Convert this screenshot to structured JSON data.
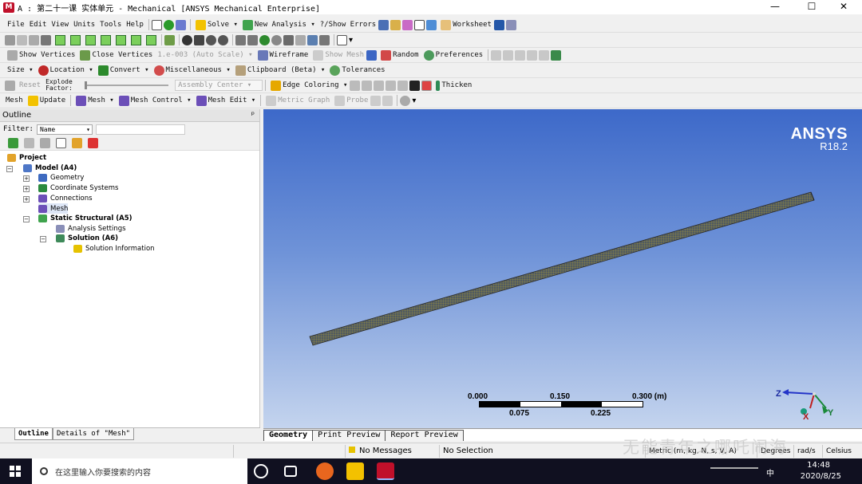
{
  "window": {
    "title": "A : 第二十一课 实体单元 - Mechanical [ANSYS Mechanical Enterprise]",
    "app_letter": "M"
  },
  "menu": [
    "File",
    "Edit",
    "View",
    "Units",
    "Tools",
    "Help"
  ],
  "toolbar1": {
    "solve": "Solve",
    "new_analysis": "New Analysis",
    "show_errors": "?/Show Errors",
    "worksheet": "Worksheet"
  },
  "toolbar2": {
    "show_vertices": "Show Vertices",
    "close_vertices": "Close Vertices",
    "auto_scale_value": "1.e-003 (Auto Scale)",
    "wireframe": "Wireframe",
    "show_mesh": "Show Mesh",
    "random": "Random",
    "preferences": "Preferences"
  },
  "toolbar3": {
    "size": "Size",
    "location": "Location",
    "convert": "Convert",
    "miscellaneous": "Miscellaneous",
    "clipboard": "Clipboard (Beta)",
    "tolerances": "Tolerances"
  },
  "toolbar4": {
    "reset": "Reset",
    "explode_factor": "Explode Factor:",
    "assembly_center": "Assembly Center",
    "edge_coloring": "Edge Coloring",
    "thicken": "Thicken"
  },
  "toolbar5": {
    "mesh": "Mesh",
    "update": "Update",
    "mesh_menu": "Mesh",
    "mesh_control": "Mesh Control",
    "mesh_edit": "Mesh Edit",
    "metric_graph": "Metric Graph",
    "probe": "Probe"
  },
  "outline": {
    "title": "Outline",
    "pin": "ᵖ",
    "filter_label": "Filter:",
    "filter_value": "Name",
    "tree": {
      "project": "Project",
      "model": "Model (A4)",
      "geometry": "Geometry",
      "coordinate_systems": "Coordinate Systems",
      "connections": "Connections",
      "mesh": "Mesh",
      "static_structural": "Static Structural (A5)",
      "analysis_settings": "Analysis Settings",
      "solution": "Solution (A6)",
      "solution_information": "Solution Information"
    },
    "tabs": [
      "Outline",
      "Details of \"Mesh\""
    ]
  },
  "viewport": {
    "brand": "ANSYS",
    "version": "R18.2",
    "scale_top": [
      "0.000",
      "0.150",
      "0.300 (m)"
    ],
    "scale_bottom": [
      "0.075",
      "0.225"
    ],
    "triad": {
      "x": "X",
      "y": "Y",
      "z": "Z"
    },
    "tabs": [
      "Geometry",
      "Print Preview",
      "Report Preview"
    ]
  },
  "status": {
    "messages": "No Messages",
    "selection": "No Selection",
    "units": "Metric (m, kg, N, s, V, A)",
    "degrees": "Degrees",
    "rad_s": "rad/s",
    "celsius": "Celsius"
  },
  "watermark": "无能青年之哪吒闹海",
  "taskbar": {
    "search_placeholder": "在这里输入你要搜索的内容",
    "time": "14:48",
    "date": "2020/8/25",
    "ime": "中"
  }
}
